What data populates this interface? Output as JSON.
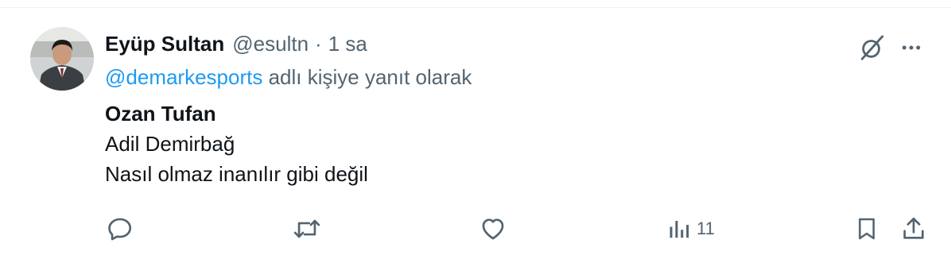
{
  "tweet": {
    "author": {
      "display_name": "Eyüp Sultan",
      "handle": "@esultn",
      "separator": "·",
      "time": "1 sa"
    },
    "reply_to": {
      "mention": "@demarkesports",
      "suffix": " adlı kişiye yanıt olarak"
    },
    "lines": [
      "Ozan Tufan",
      "Adil Demirbağ",
      "Nasıl olmaz inanılır gibi değil"
    ],
    "actions": {
      "reply": "reply-icon",
      "retweet": "retweet-icon",
      "like": "heart-icon",
      "views": {
        "icon": "views-icon",
        "count": "11"
      },
      "bookmark": "bookmark-icon",
      "share": "share-icon"
    },
    "top_icons": {
      "grok": "grok-icon",
      "more": "more-icon"
    }
  },
  "colors": {
    "text_primary": "#0f1419",
    "text_secondary": "#536471",
    "link": "#1d9bf0"
  }
}
